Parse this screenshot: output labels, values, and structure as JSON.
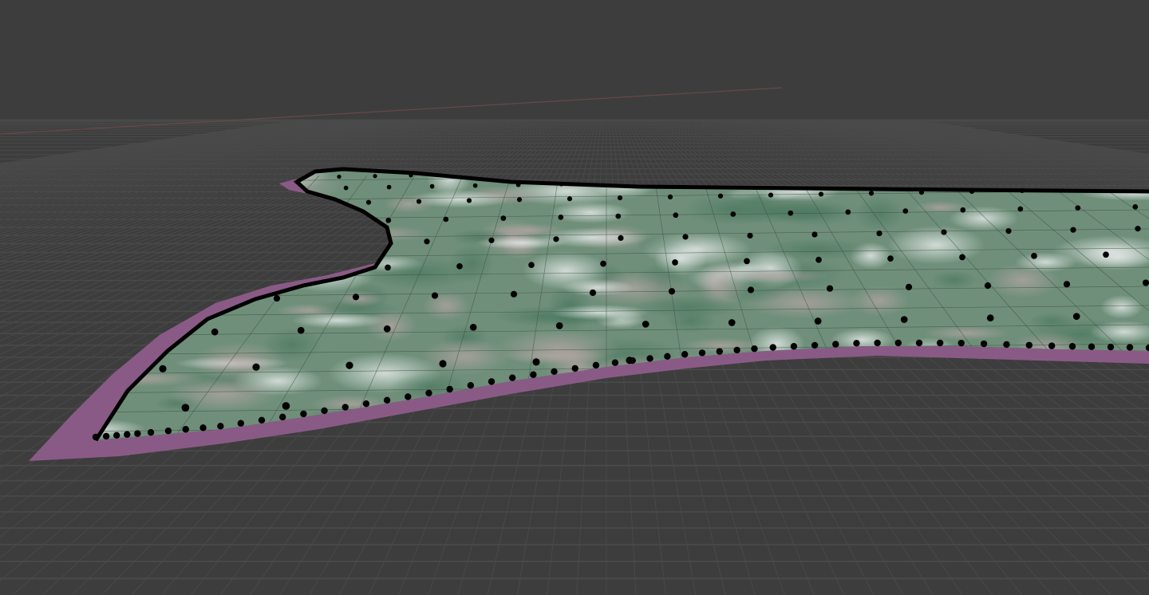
{
  "viewport": {
    "mode": "3d-perspective",
    "background_color": "#3d3d3d",
    "grid_line_color": "#4a4a4a",
    "x_axis_color": "#6a4848"
  },
  "terrain": {
    "texture_description_colors": [
      "#6f8f7a",
      "#a9b9a8",
      "#c8d3cc",
      "#5b7a66",
      "#8aa08d",
      "#b7a9a3"
    ],
    "underside_color": "#8a5a86",
    "outline_color": "#000000",
    "vertex_dot_color": "#000000",
    "wire_color": "#3a4a40"
  }
}
